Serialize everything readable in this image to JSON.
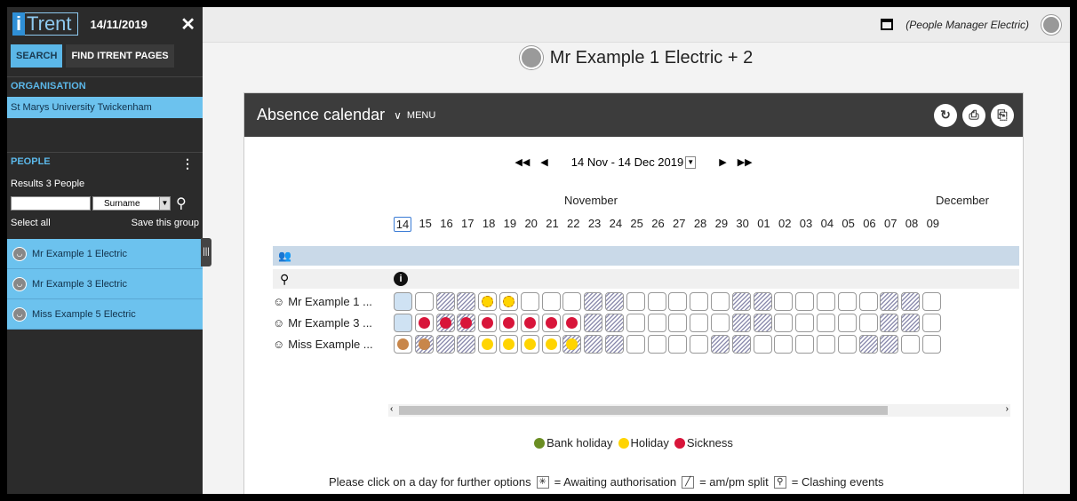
{
  "sidebar": {
    "logo_i": "i",
    "logo_text": "Trent",
    "date": "14/11/2019",
    "close_glyph": "✕",
    "tabs": [
      "SEARCH",
      "FIND ITRENT PAGES"
    ],
    "org_heading": "ORGANISATION",
    "org_value": "St Marys University Twickenham",
    "people_heading": "PEOPLE",
    "results": "Results 3 People",
    "search_placeholder": "",
    "sort_value": "Surname",
    "select_all": "Select all",
    "save_group": "Save this group",
    "people": [
      "Mr Example 1 Electric",
      "Mr Example 3 Electric",
      "Miss Example 5 Electric"
    ]
  },
  "topbar": {
    "role": "(People Manager Electric)"
  },
  "person_title": "Mr Example 1 Electric + 2",
  "calendar": {
    "title": "Absence calendar",
    "menu_label": "MENU",
    "range": "14 Nov - 14 Dec 2019",
    "month1": "November",
    "month2": "December",
    "days": [
      "14",
      "15",
      "16",
      "17",
      "18",
      "19",
      "20",
      "21",
      "22",
      "23",
      "24",
      "25",
      "26",
      "27",
      "28",
      "29",
      "30",
      "01",
      "02",
      "03",
      "04",
      "05",
      "06",
      "07",
      "08",
      "09"
    ],
    "rows": [
      {
        "name": "Mr Example 1 ...",
        "cells": [
          "t",
          "",
          "h",
          "h",
          "A",
          "A",
          "",
          "",
          "",
          "h",
          "h",
          "",
          "",
          "",
          "",
          "",
          "h",
          "h",
          "",
          "",
          "",
          "",
          "",
          "h",
          "h",
          ""
        ]
      },
      {
        "name": "Mr Example 3 ...",
        "cells": [
          "t",
          "S",
          "hS",
          "hS",
          "S",
          "S",
          "S",
          "S",
          "S",
          "h",
          "h",
          "",
          "",
          "",
          "",
          "",
          "h",
          "h",
          "",
          "",
          "",
          "",
          "",
          "h",
          "h",
          ""
        ]
      },
      {
        "name": "Miss Example ...",
        "cells": [
          "O",
          "hO",
          "h",
          "h",
          "H",
          "H",
          "H",
          "H",
          "hH",
          "h",
          "h",
          "",
          "",
          "",
          "",
          "h",
          "h",
          "",
          "",
          "",
          "",
          "",
          "h",
          "h",
          "",
          ""
        ]
      }
    ],
    "legend": [
      {
        "label": "Bank holiday",
        "color": "#6b8e23"
      },
      {
        "label": "Holiday",
        "color": "#ffd400"
      },
      {
        "label": "Sickness",
        "color": "#d8153a"
      }
    ],
    "footer_text": "Please click on a day for further options",
    "key_awaiting": "= Awaiting authorisation",
    "key_split": "= am/pm split",
    "key_clash": "= Clashing events"
  }
}
